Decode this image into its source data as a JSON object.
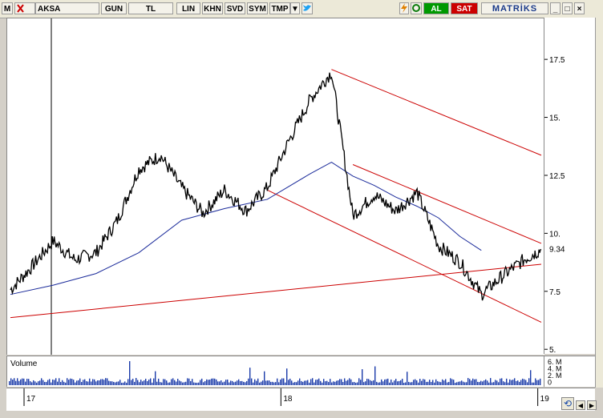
{
  "toolbar": {
    "app_icon": "M",
    "symbol": "AKSA",
    "period": "GUN",
    "currency": "TL",
    "scale": "LIN",
    "btn_khn": "KHN",
    "btn_svd": "SVD",
    "btn_sym": "SYM",
    "btn_tmp": "TMP",
    "buy": "AL",
    "sell": "SAT",
    "brand": "MATRİKS",
    "colors": {
      "buy_bg": "#009900",
      "sell_bg": "#cc0000",
      "brand": "#1a3a8a"
    }
  },
  "volume_label": "Volume",
  "chart_data": {
    "type": "line",
    "title": "",
    "xlabel": "",
    "ylabel": "",
    "ylim": [
      4.8,
      19.3
    ],
    "y_ticks": [
      "17.5",
      "15.",
      "12.5",
      "10.",
      "7.5",
      "5."
    ],
    "y_tick_values": [
      17.5,
      15,
      12.5,
      10,
      7.5,
      5
    ],
    "last_price_label": "9.34",
    "last_price": 9.34,
    "x_tick_labels": [
      "17",
      "18",
      "19"
    ],
    "x_ticks_month_index": [
      0,
      12,
      24
    ],
    "price_series": {
      "name": "",
      "month_index": [
        0,
        1,
        2,
        3,
        4,
        5,
        6,
        7,
        8,
        9,
        10,
        11,
        12,
        13,
        14,
        15,
        16,
        17,
        18,
        19,
        20,
        21,
        22,
        23,
        24,
        24.8
      ],
      "values": [
        7.6,
        8.6,
        9.7,
        8.9,
        9.2,
        10.6,
        12.8,
        13.4,
        12.0,
        10.9,
        11.9,
        11.0,
        12.0,
        14.0,
        15.8,
        17.0,
        10.8,
        11.7,
        11.0,
        11.8,
        9.5,
        8.8,
        7.4,
        8.2,
        8.9,
        9.34
      ]
    },
    "moving_average": {
      "name": "",
      "month_index": [
        0,
        2,
        4,
        6,
        8,
        10,
        12,
        14,
        15,
        16,
        17,
        18,
        19,
        20,
        21,
        22
      ],
      "values": [
        7.4,
        7.8,
        8.3,
        9.2,
        10.6,
        11.1,
        11.5,
        12.6,
        13.1,
        12.5,
        12.1,
        11.6,
        11.2,
        10.7,
        9.9,
        9.3
      ]
    },
    "volume": {
      "axis_labels": [
        "6. M",
        "4. M",
        "2. M",
        "0"
      ]
    },
    "trendlines": [
      {
        "color": "#cc0000",
        "from": [
          0,
          6.4
        ],
        "to": [
          24.8,
          8.7
        ]
      },
      {
        "color": "#cc0000",
        "from": [
          15,
          17.1
        ],
        "to": [
          24.8,
          13.4
        ]
      },
      {
        "color": "#cc0000",
        "from": [
          12,
          11.9
        ],
        "to": [
          24.8,
          6.2
        ]
      },
      {
        "color": "#cc0000",
        "from": [
          16,
          13.0
        ],
        "to": [
          24.8,
          9.6
        ]
      }
    ],
    "grid": false,
    "legend": "none"
  }
}
